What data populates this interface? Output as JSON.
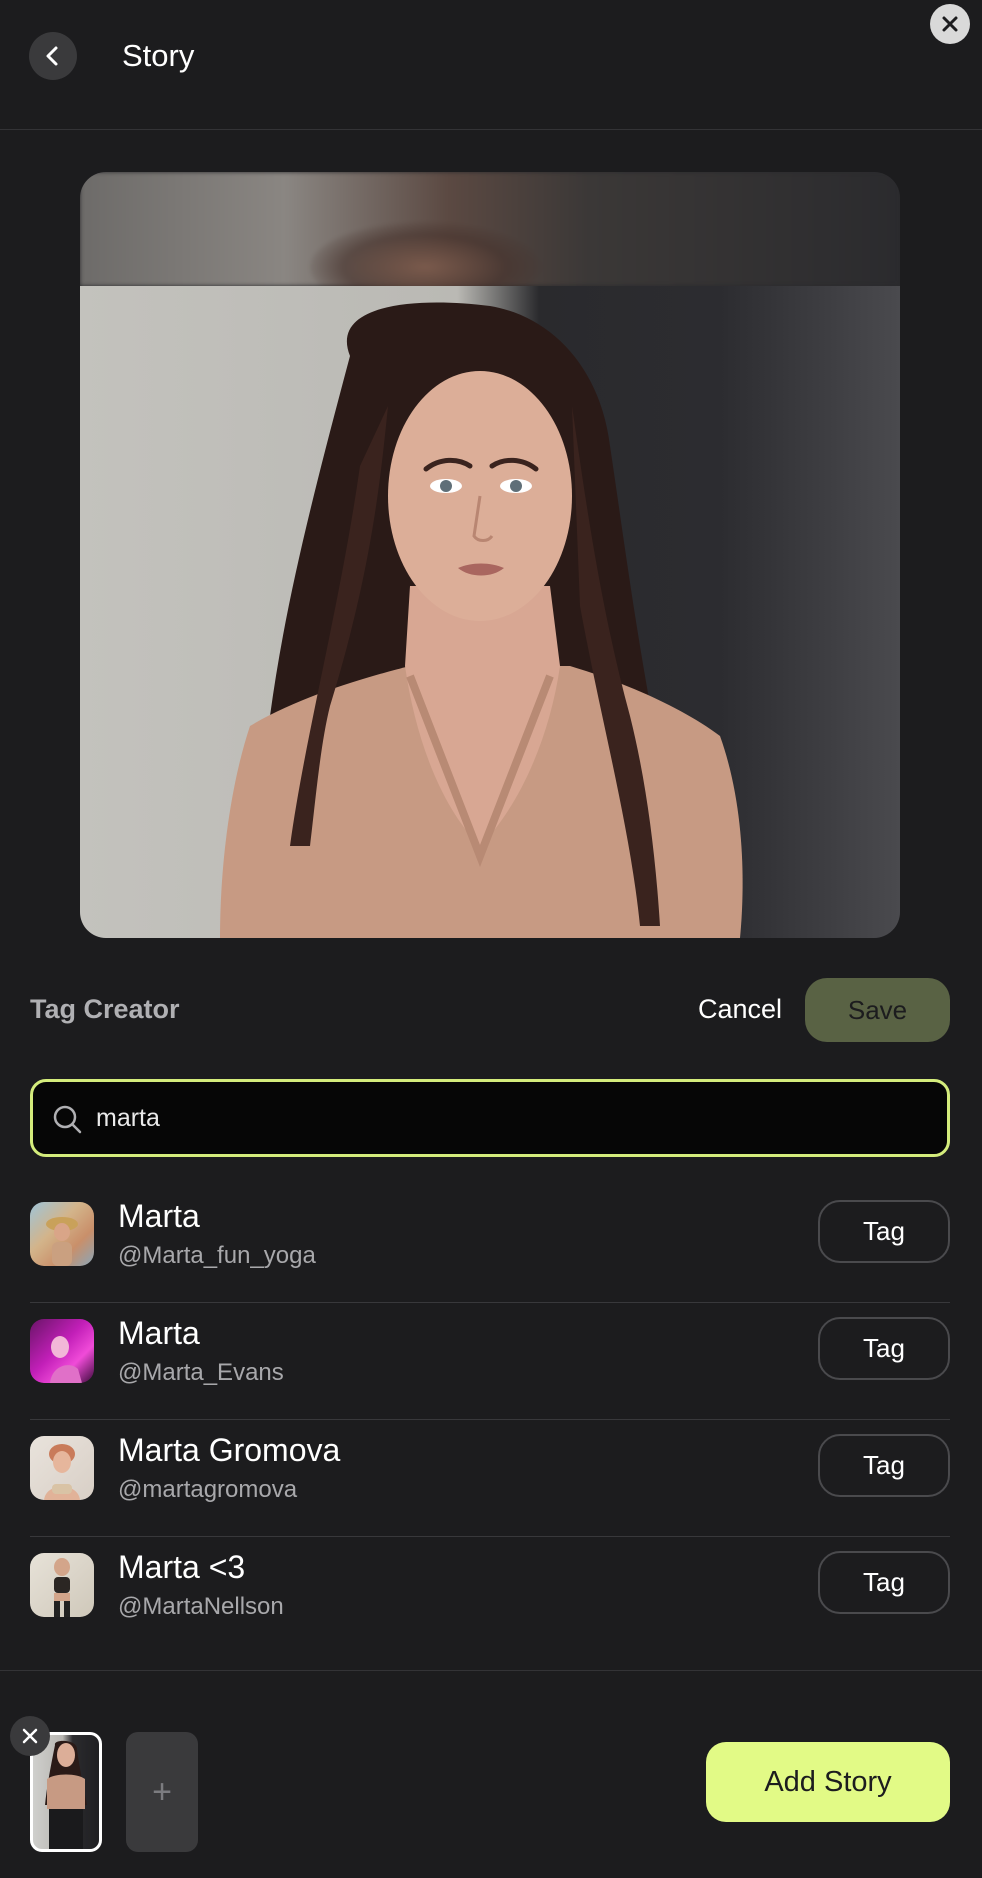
{
  "header": {
    "title": "Story"
  },
  "tag_creator": {
    "title": "Tag Creator",
    "cancel_label": "Cancel",
    "save_label": "Save"
  },
  "search": {
    "value": "marta"
  },
  "results": [
    {
      "name": "Marta",
      "handle": "@Marta_fun_yoga",
      "tag_label": "Tag"
    },
    {
      "name": "Marta",
      "handle": "@Marta_Evans",
      "tag_label": "Tag"
    },
    {
      "name": "Marta Gromova",
      "handle": "@martagromova",
      "tag_label": "Tag"
    },
    {
      "name": "Marta <3",
      "handle": "@MartaNellson",
      "tag_label": "Tag"
    }
  ],
  "bottom_bar": {
    "add_story_label": "Add Story",
    "add_media_glyph": "+"
  },
  "colors": {
    "background": "#1c1c1e",
    "accent": "#e2fa86",
    "search_border": "#d4ec7c",
    "save_disabled": "#596244"
  },
  "icons": [
    "close-icon",
    "chevron-left-icon",
    "search-icon",
    "plus-icon"
  ]
}
